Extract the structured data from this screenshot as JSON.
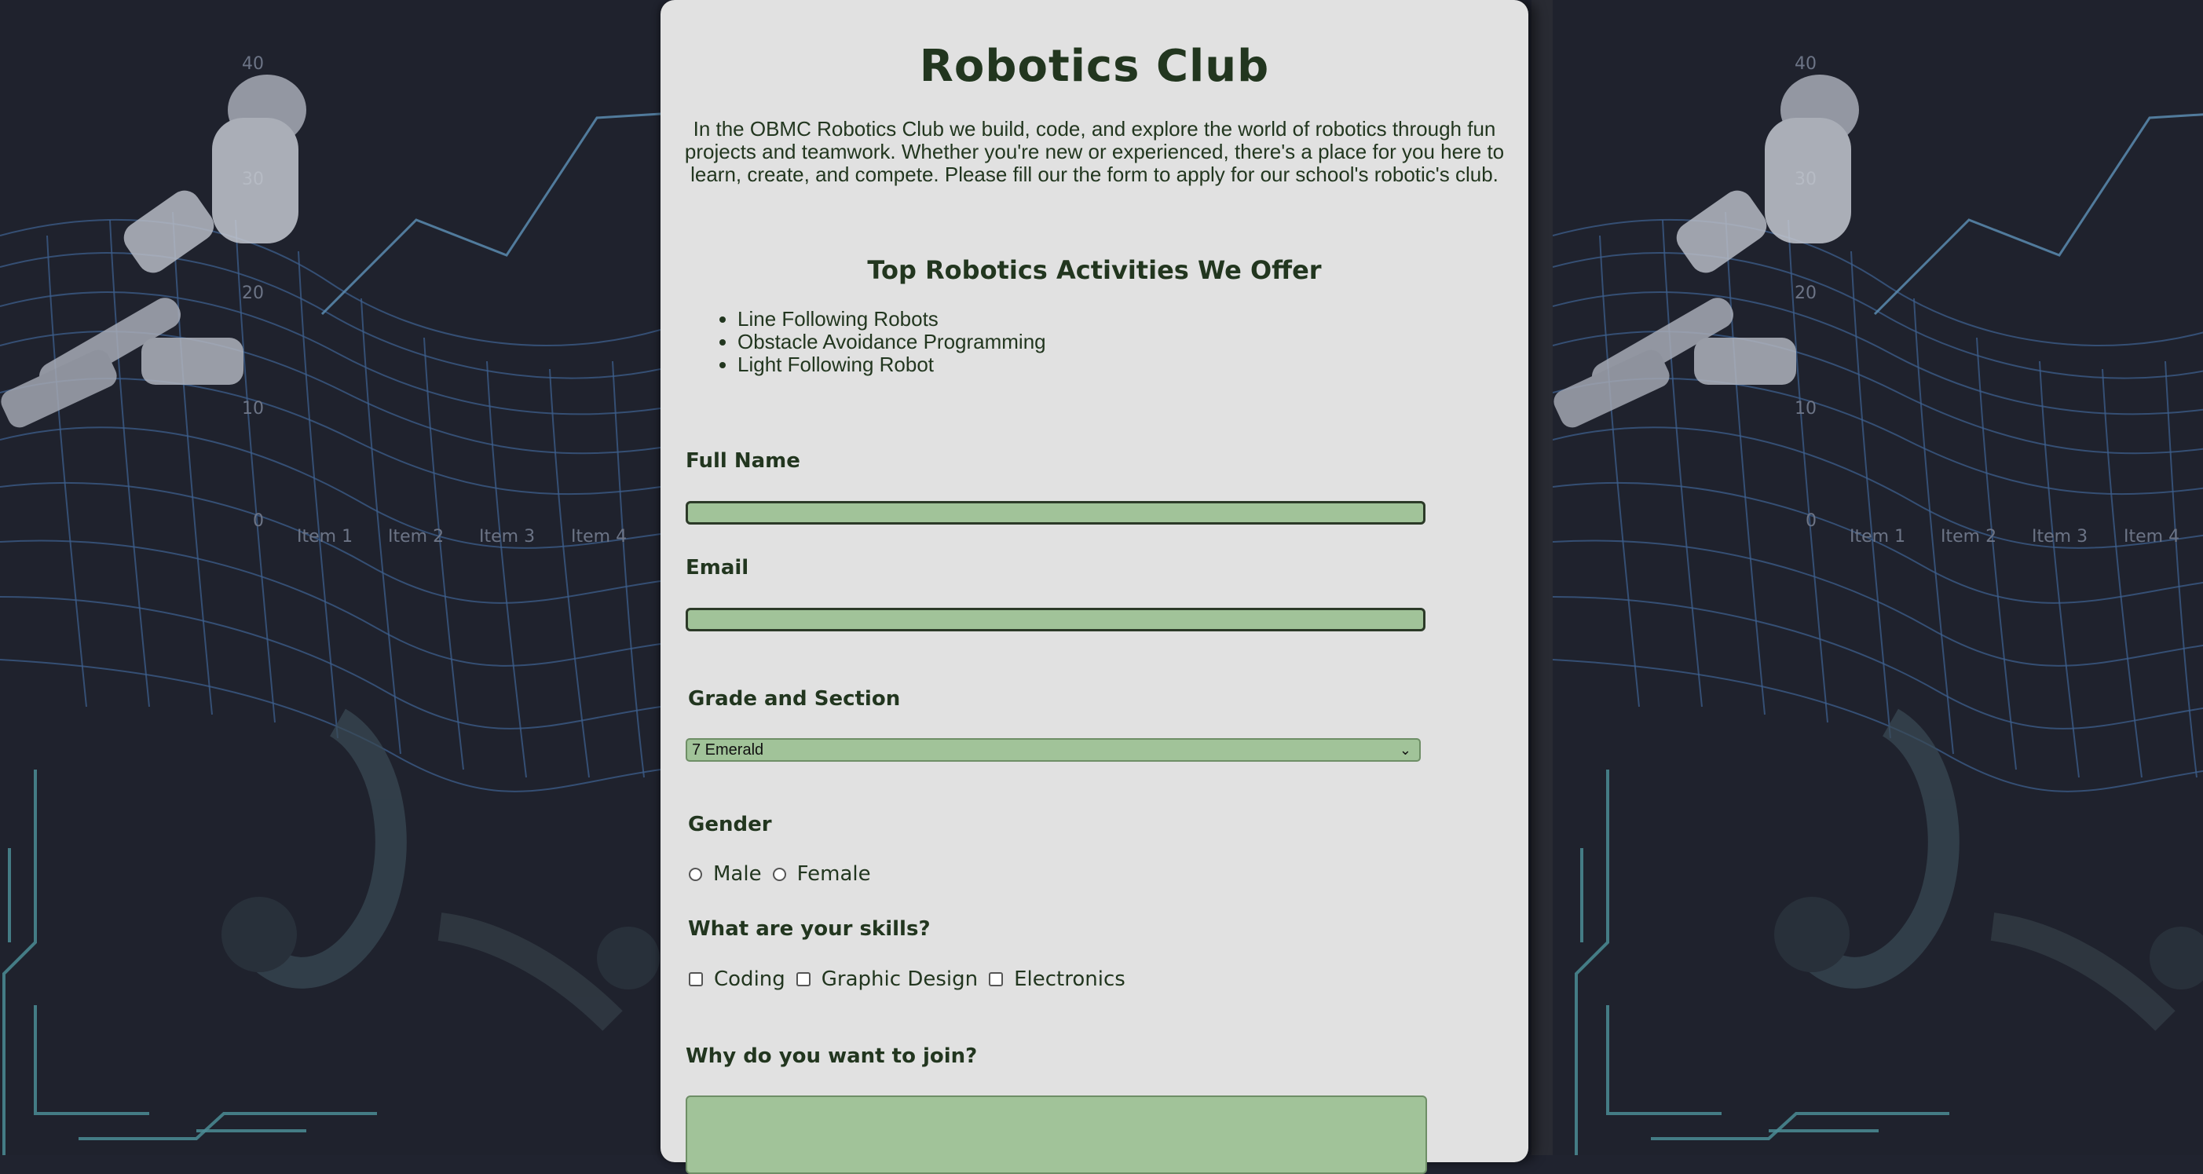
{
  "header": {
    "title": "Robotics Club"
  },
  "intro": "In the OBMC Robotics Club we build, code, and explore the world of robotics through fun projects and teamwork. Whether you're new or experienced, there's a place for you here to learn, create, and compete. Please fill our the form to apply for our school's robotic's club.",
  "activities": {
    "title": "Top Robotics Activities We Offer",
    "items": [
      "Line Following Robots",
      "Obstacle Avoidance Programming",
      "Light Following Robot"
    ]
  },
  "form": {
    "full_name": {
      "label": "Full Name",
      "value": ""
    },
    "email": {
      "label": "Email",
      "value": ""
    },
    "grade": {
      "label": "Grade and Section",
      "selected": "7 Emerald"
    },
    "gender": {
      "label": "Gender",
      "options": [
        "Male",
        "Female"
      ]
    },
    "skills": {
      "label": "What are your skills?",
      "options": [
        "Coding",
        "Graphic Design",
        "Electronics"
      ]
    },
    "reason": {
      "label": "Why do you want to join?",
      "value": ""
    }
  },
  "background": {
    "axis_values": [
      "40",
      "30",
      "20",
      "10",
      "0"
    ],
    "axis_items": [
      "Item 1",
      "Item 2",
      "Item 3",
      "Item 4"
    ]
  },
  "colors": {
    "card": "#e1e1e1",
    "input": "#a1c399",
    "text": "#22361f",
    "page": "#20232f"
  }
}
